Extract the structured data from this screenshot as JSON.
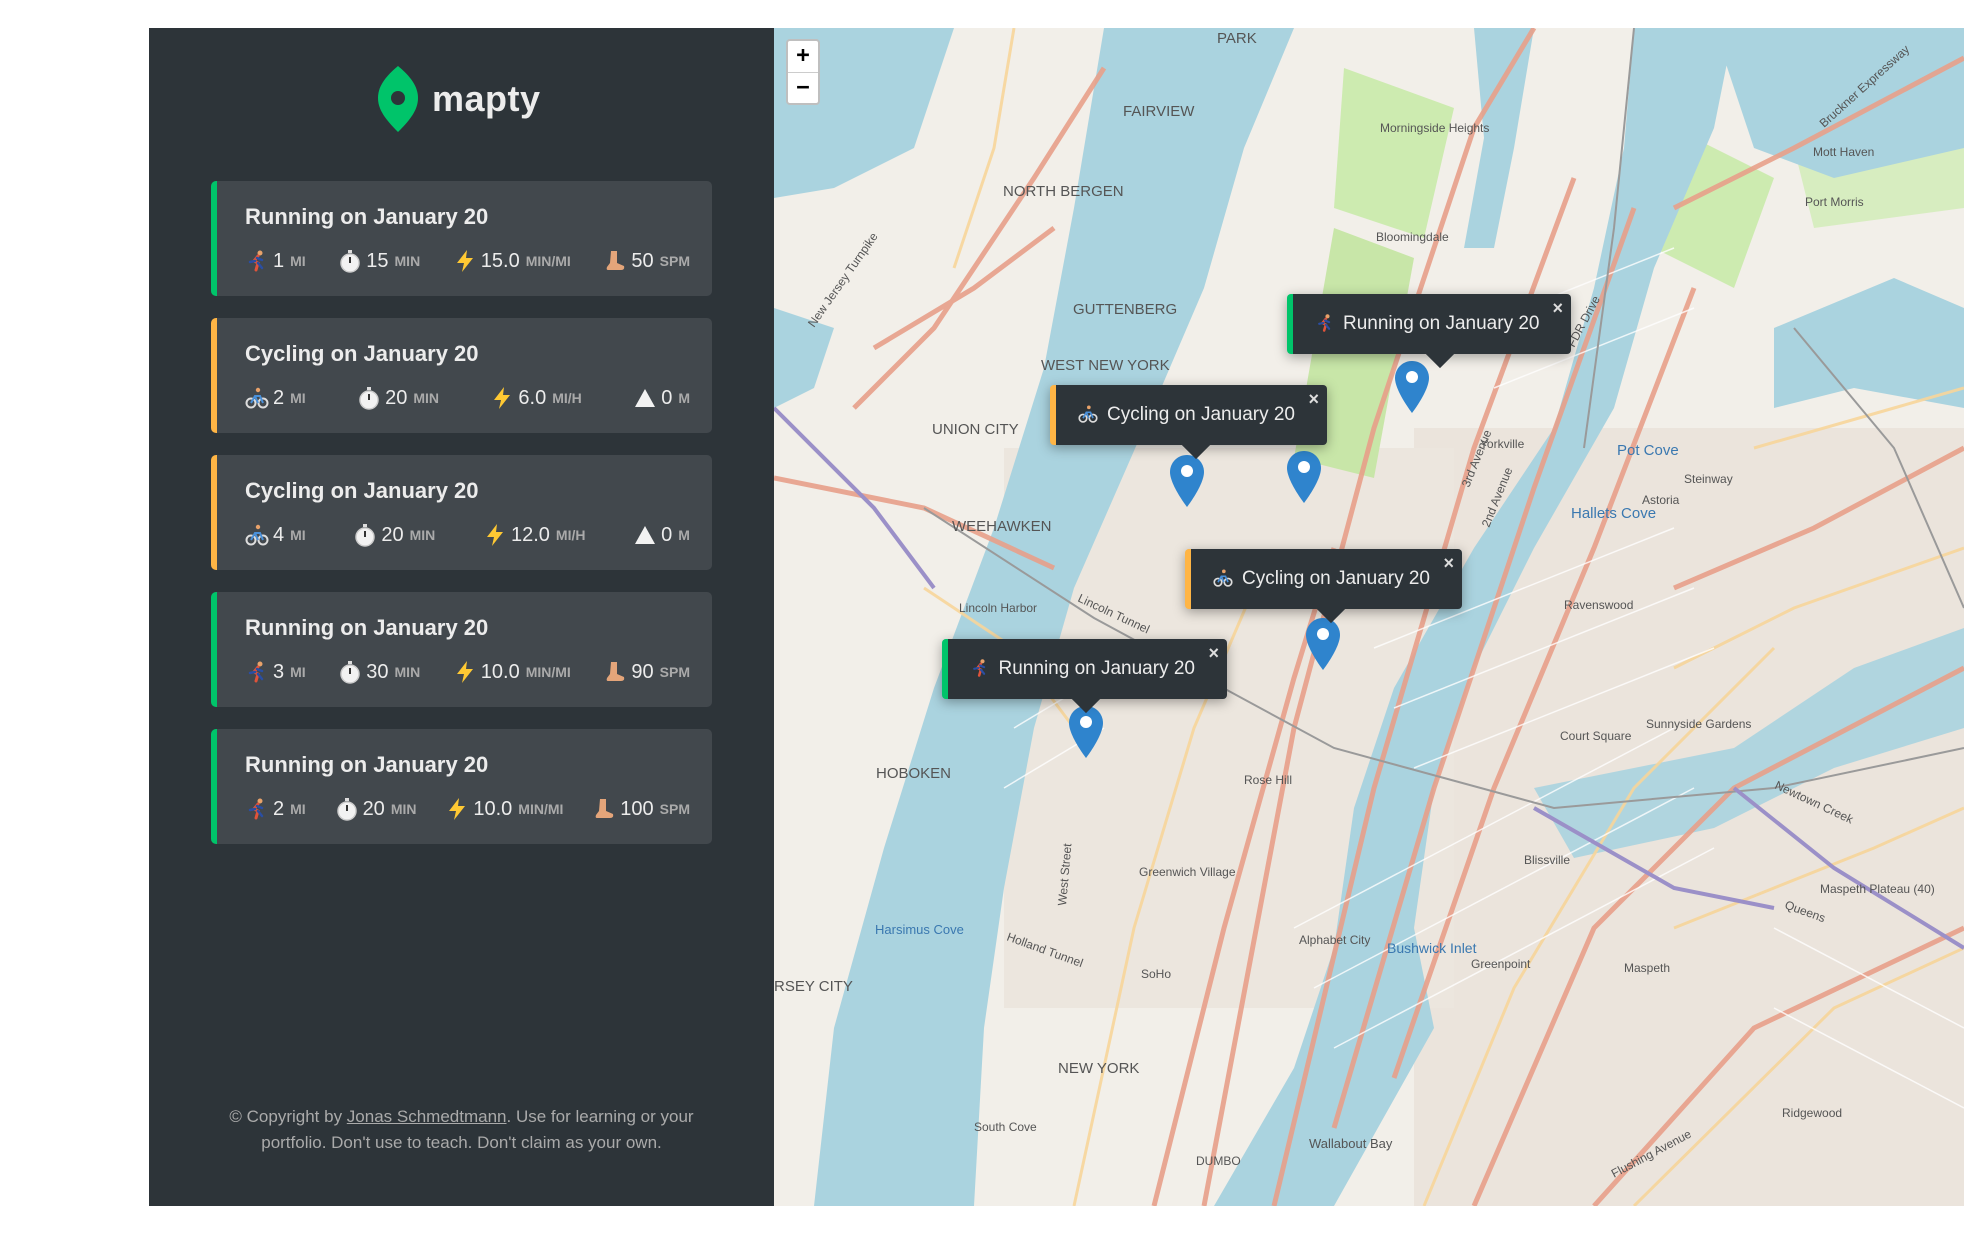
{
  "app": {
    "name": "mapty",
    "brand_color": "#00c46a",
    "cycling_color": "#ffb545"
  },
  "workouts": [
    {
      "type": "running",
      "title": "Running on January 20",
      "details": [
        {
          "icon": "runner-icon",
          "value": "1",
          "unit": "MI"
        },
        {
          "icon": "stopwatch-icon",
          "value": "15",
          "unit": "MIN"
        },
        {
          "icon": "lightning-icon",
          "value": "15.0",
          "unit": "MIN/MI"
        },
        {
          "icon": "foot-icon",
          "value": "50",
          "unit": "SPM"
        }
      ]
    },
    {
      "type": "cycling",
      "title": "Cycling on January 20",
      "details": [
        {
          "icon": "cyclist-icon",
          "value": "2",
          "unit": "MI"
        },
        {
          "icon": "stopwatch-icon",
          "value": "20",
          "unit": "MIN"
        },
        {
          "icon": "lightning-icon",
          "value": "6.0",
          "unit": "MI/H"
        },
        {
          "icon": "mountain-icon",
          "value": "0",
          "unit": "M"
        }
      ]
    },
    {
      "type": "cycling",
      "title": "Cycling on January 20",
      "details": [
        {
          "icon": "cyclist-icon",
          "value": "4",
          "unit": "MI"
        },
        {
          "icon": "stopwatch-icon",
          "value": "20",
          "unit": "MIN"
        },
        {
          "icon": "lightning-icon",
          "value": "12.0",
          "unit": "MI/H"
        },
        {
          "icon": "mountain-icon",
          "value": "0",
          "unit": "M"
        }
      ]
    },
    {
      "type": "running",
      "title": "Running on January 20",
      "details": [
        {
          "icon": "runner-icon",
          "value": "3",
          "unit": "MI"
        },
        {
          "icon": "stopwatch-icon",
          "value": "30",
          "unit": "MIN"
        },
        {
          "icon": "lightning-icon",
          "value": "10.0",
          "unit": "MIN/MI"
        },
        {
          "icon": "foot-icon",
          "value": "90",
          "unit": "SPM"
        }
      ]
    },
    {
      "type": "running",
      "title": "Running on January 20",
      "details": [
        {
          "icon": "runner-icon",
          "value": "2",
          "unit": "MI"
        },
        {
          "icon": "stopwatch-icon",
          "value": "20",
          "unit": "MIN"
        },
        {
          "icon": "lightning-icon",
          "value": "10.0",
          "unit": "MIN/MI"
        },
        {
          "icon": "foot-icon",
          "value": "100",
          "unit": "SPM"
        }
      ]
    }
  ],
  "copyright": {
    "prefix": "© Copyright by ",
    "author": "Jonas Schmedtmann",
    "suffix": ". Use for learning or your portfolio. Don't use to teach. Don't claim as your own."
  },
  "map": {
    "zoom_in": "+",
    "zoom_out": "−",
    "popups": [
      {
        "type": "running",
        "label": "Running on January 20",
        "close": "×"
      },
      {
        "type": "cycling",
        "label": "Cycling on January 20",
        "close": "×"
      },
      {
        "type": "cycling",
        "label": "Cycling on January 20",
        "close": "×"
      },
      {
        "type": "running",
        "label": "Running on January 20",
        "close": "×"
      }
    ],
    "place_labels": [
      "PARK",
      "FAIRVIEW",
      "NORTH BERGEN",
      "GUTTENBERG",
      "WEST NEW YORK",
      "UNION CITY",
      "WEEHAWKEN",
      "HOBOKEN",
      "NEW YORK",
      "RSEY CITY",
      "Pot Cove",
      "Hallets Cove",
      "Astoria",
      "Steinway",
      "Ravenswood",
      "Yorkville",
      "Morningside Heights",
      "Bloomingdale",
      "Harsimus Cove",
      "Bushwick Inlet",
      "Greenpoint",
      "Maspeth",
      "Blissville",
      "Sunnyside Gardens",
      "Court Square",
      "Rose Hill",
      "Greenwich Village",
      "Alphabet City",
      "SoHo",
      "Wallabout Bay",
      "Maspeth Plateau (40)",
      "Ridgewood",
      "Port Morris",
      "Mott Haven",
      "Lincoln Harbor",
      "South Cove",
      "DUMBO"
    ],
    "road_labels": [
      "New Jersey Turnpike",
      "Bruckner Expressway",
      "FDR Drive",
      "Holland Tunnel",
      "Lincoln Tunnel",
      "West Street",
      "Flushing Avenue",
      "3rd Avenue",
      "2nd Avenue",
      "Queens",
      "Newtown Creek"
    ]
  }
}
